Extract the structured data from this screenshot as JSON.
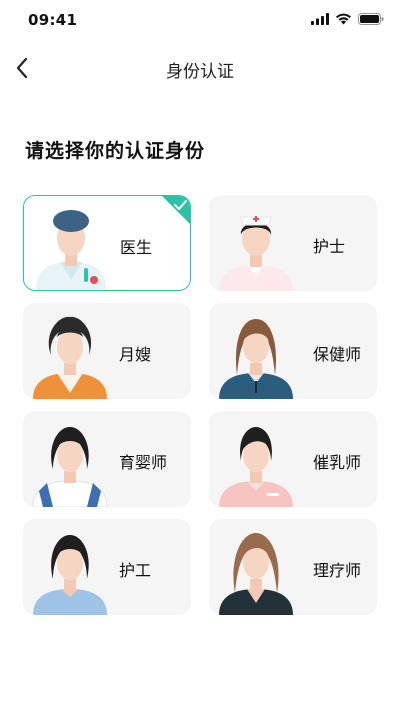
{
  "status_bar": {
    "time": "09:41",
    "icons": [
      "signal-icon",
      "wifi-icon",
      "battery-icon"
    ]
  },
  "nav": {
    "title": "身份认证",
    "back_icon": "chevron-left-icon"
  },
  "heading": "请选择你的认证身份",
  "accent_color": "#2dc2a8",
  "roles": [
    {
      "label": "医生",
      "selected": true,
      "icon": "doctor-avatar-icon"
    },
    {
      "label": "护士",
      "selected": false,
      "icon": "nurse-avatar-icon"
    },
    {
      "label": "月嫂",
      "selected": false,
      "icon": "maternity-matron-avatar-icon"
    },
    {
      "label": "保健师",
      "selected": false,
      "icon": "health-care-worker-avatar-icon"
    },
    {
      "label": "育婴师",
      "selected": false,
      "icon": "nanny-avatar-icon"
    },
    {
      "label": "催乳师",
      "selected": false,
      "icon": "lactation-consultant-avatar-icon"
    },
    {
      "label": "护工",
      "selected": false,
      "icon": "caregiver-avatar-icon"
    },
    {
      "label": "理疗师",
      "selected": false,
      "icon": "physiotherapist-avatar-icon"
    }
  ]
}
